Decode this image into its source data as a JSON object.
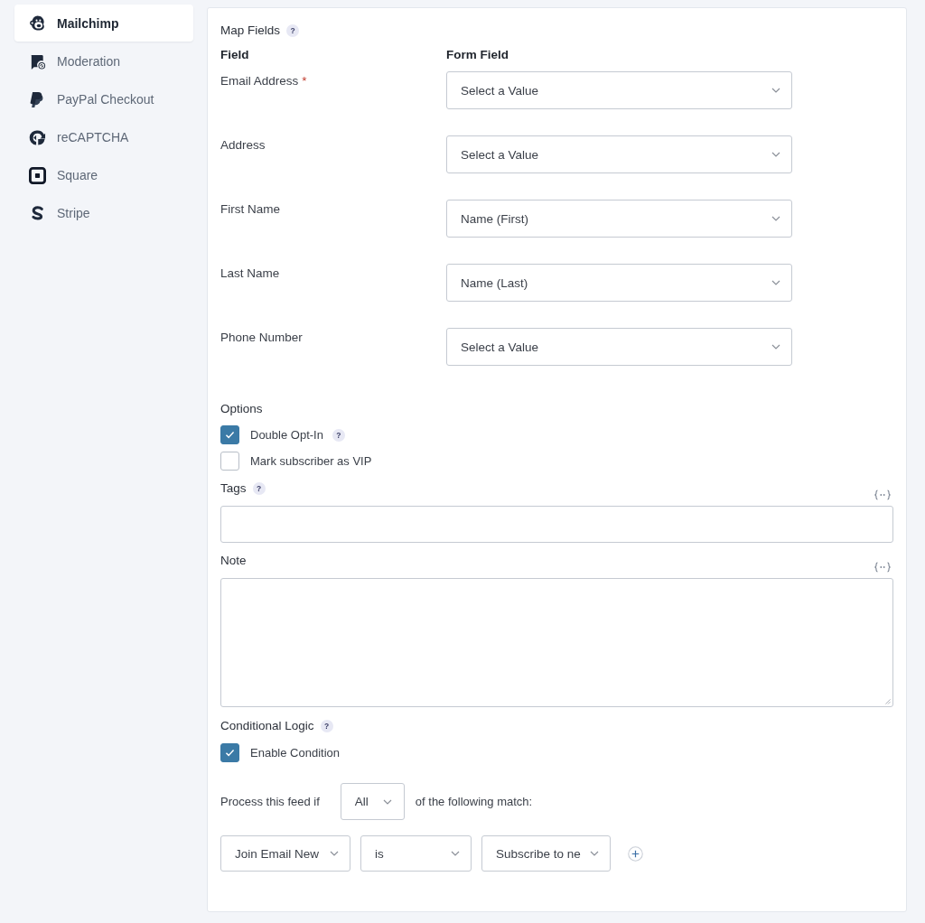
{
  "sidebar": {
    "items": [
      {
        "label": "Mailchimp",
        "selected": true
      },
      {
        "label": "Moderation",
        "selected": false
      },
      {
        "label": "PayPal Checkout",
        "selected": false
      },
      {
        "label": "reCAPTCHA",
        "selected": false
      },
      {
        "label": "Square",
        "selected": false
      },
      {
        "label": "Stripe",
        "selected": false
      }
    ]
  },
  "map_fields": {
    "title": "Map Fields",
    "help": "?",
    "columns": [
      "Field",
      "Form Field"
    ],
    "rows": [
      {
        "label": "Email Address",
        "required_mark": "*",
        "value": "Select a Value"
      },
      {
        "label": "Address",
        "value": "Select a Value"
      },
      {
        "label": "First Name",
        "value": "Name (First)"
      },
      {
        "label": "Last Name",
        "value": "Name (Last)"
      },
      {
        "label": "Phone Number",
        "value": "Select a Value"
      }
    ]
  },
  "options": {
    "title": "Options",
    "checkboxes": [
      {
        "label": "Double Opt-In",
        "checked": true,
        "help": "?"
      },
      {
        "label": "Mark subscriber as VIP",
        "checked": false
      }
    ]
  },
  "tags": {
    "label": "Tags",
    "help": "?"
  },
  "note": {
    "label": "Note"
  },
  "conditional_logic": {
    "title": "Conditional Logic",
    "help": "?",
    "enable": {
      "label": "Enable Condition",
      "checked": true
    },
    "prefix": "Process this feed if",
    "match": "All",
    "suffix": "of the following match:",
    "rule": {
      "field": "Join Email New",
      "operator": "is",
      "value": "Subscribe to ne"
    }
  }
}
